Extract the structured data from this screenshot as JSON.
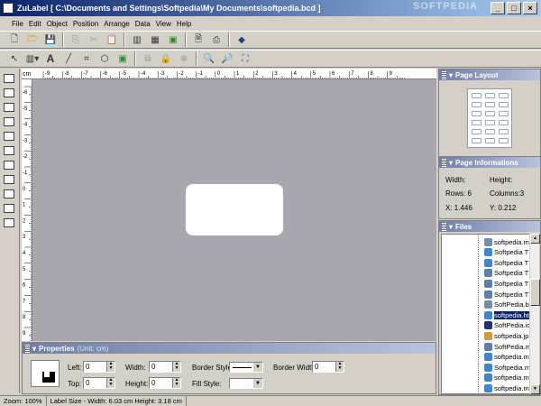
{
  "window": {
    "title": "ZuLabel  [ C:\\Documents and Settings\\Softpedia\\My Documents\\softpedia.bcd ]",
    "watermark": "SOFTPEDIA"
  },
  "menu": [
    "File",
    "Edit",
    "Object",
    "Position",
    "Arrange",
    "Data",
    "View",
    "Help"
  ],
  "toolbar1_icons": [
    "new-icon",
    "open-icon",
    "save-icon",
    "copy-icon",
    "cut-icon",
    "paste-icon",
    "columns-icon",
    "grid-icon",
    "image-icon",
    "page-icon",
    "print-icon",
    "book-icon"
  ],
  "toolbar2_icons": [
    "pointer-icon",
    "barcode-icon",
    "text-icon",
    "line-icon",
    "crop-icon",
    "polygon-icon",
    "picture-icon",
    "group-icon",
    "lock-icon",
    "unlock-icon",
    "zoom-in-icon",
    "zoom-out-icon",
    "zoom-fit-icon"
  ],
  "ruler": {
    "unit": "cm",
    "h_ticks": [
      "-9",
      "-8",
      "-7",
      "-6",
      "-5",
      "-4",
      "-3",
      "-2",
      "-1",
      "0",
      "1",
      "2",
      "3",
      "4",
      "5",
      "6",
      "7",
      "8",
      "9"
    ],
    "v_ticks": [
      "-6",
      "-5",
      "-4",
      "-3",
      "-2",
      "-1",
      "0",
      "1",
      "2",
      "3",
      "4",
      "5",
      "6",
      "7",
      "8",
      "9"
    ]
  },
  "properties": {
    "title": "Properties",
    "unit": "(Unit: cm)",
    "left_label": "Left:",
    "left_value": "0",
    "top_label": "Top:",
    "top_value": "0",
    "width_label": "Width:",
    "width_value": "0",
    "height_label": "Height:",
    "height_value": "0",
    "border_style_label": "Border Style:",
    "fill_style_label": "Fill Style:",
    "border_width_label": "Border Width:",
    "border_width_value": "0"
  },
  "page_layout": {
    "title": "Page Layout",
    "rows": 6,
    "columns": 3
  },
  "page_info": {
    "title": "Page Informations",
    "width_label": "Width:",
    "height_label": "Height:",
    "rows_label": "Rows: 6",
    "columns_label": "Columns:3",
    "x_label": "X:  1.446",
    "y_label": "Y:  0.212"
  },
  "files": {
    "title": "Files",
    "items": [
      {
        "name": "softpedia.m",
        "icon": "doc"
      },
      {
        "name": "Softpedia T",
        "icon": "ie"
      },
      {
        "name": "Softpedia T",
        "icon": "ie"
      },
      {
        "name": "Softpedia T",
        "icon": "notepad"
      },
      {
        "name": "Softpedia T",
        "icon": "notepad"
      },
      {
        "name": "Softpedia T",
        "icon": "notepad"
      },
      {
        "name": "SoftPedia.b",
        "icon": "doc"
      },
      {
        "name": "softpedia.ht",
        "icon": "ie",
        "selected": true
      },
      {
        "name": "SoftPedia.ic",
        "icon": "s"
      },
      {
        "name": "softpedia.jp",
        "icon": "img"
      },
      {
        "name": "SoftPedia.m",
        "icon": "notepad"
      },
      {
        "name": "softpedia.m",
        "icon": "ie"
      },
      {
        "name": "Softpedia.m",
        "icon": "ie"
      },
      {
        "name": "softpedia.m",
        "icon": "ie"
      },
      {
        "name": "softpedia.m",
        "icon": "ie"
      }
    ]
  },
  "status": {
    "zoom": "Zoom: 100%",
    "label_size": "Label Size - Width: 6.03 cm Height: 3.18 cm"
  }
}
